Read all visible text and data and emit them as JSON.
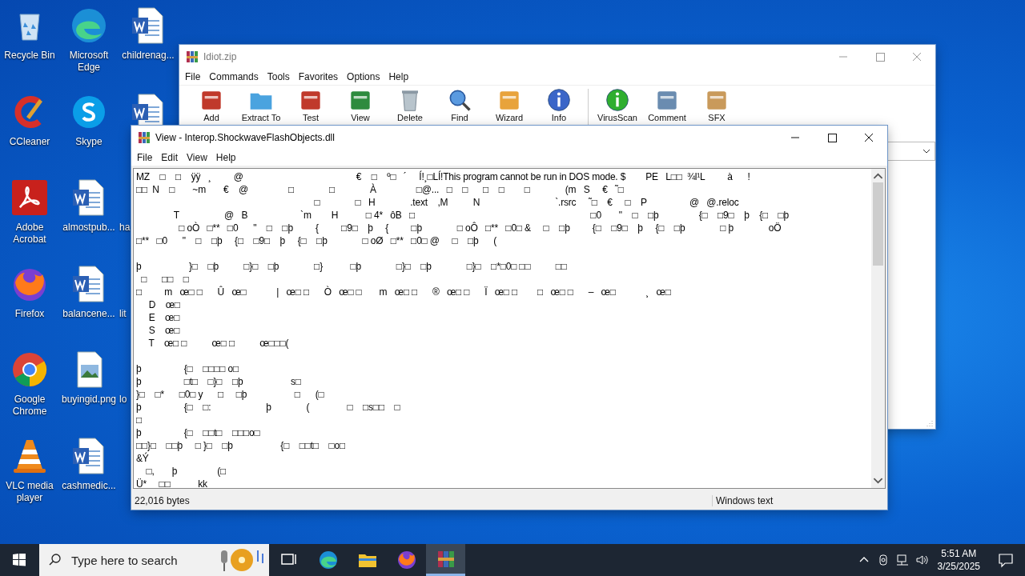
{
  "desktop": {
    "icons": [
      {
        "label": "Recycle Bin",
        "kind": "app"
      },
      {
        "label": "CCleaner",
        "kind": "app"
      },
      {
        "label": "Adobe Acrobat",
        "kind": "app"
      },
      {
        "label": "Firefox",
        "kind": "app"
      },
      {
        "label": "Google Chrome",
        "kind": "app"
      },
      {
        "label": "VLC media player",
        "kind": "app"
      },
      {
        "label": "Microsoft Edge",
        "kind": "app"
      },
      {
        "label": "Skype",
        "kind": "app"
      },
      {
        "label": "almostpub...",
        "kind": "document"
      },
      {
        "label": "balancene...",
        "kind": "document"
      },
      {
        "label": "buyingid.png",
        "kind": "image"
      },
      {
        "label": "cashmedic...",
        "kind": "document"
      },
      {
        "label": "childrenag...",
        "kind": "document"
      },
      {
        "kind": "document"
      },
      {
        "label": "ha",
        "kind": "covered"
      },
      {
        "label": "lit",
        "kind": "covered"
      },
      {
        "label": "lo",
        "kind": "covered"
      }
    ]
  },
  "archive_window": {
    "title": "Idiot.zip",
    "menu": [
      "File",
      "Commands",
      "Tools",
      "Favorites",
      "Options",
      "Help"
    ],
    "toolbar": [
      "Add",
      "Extract To",
      "Test",
      "View",
      "Delete",
      "Find",
      "Wizard",
      "Info",
      "VirusScan",
      "Comment",
      "SFX"
    ]
  },
  "viewer_window": {
    "title": "View - Interop.ShockwaveFlashObjects.dll",
    "menu": [
      "File",
      "Edit",
      "View",
      "Help"
    ],
    "lines": [
      {
        "text": "MZ    □    □    ÿÿ   ¸         @                                             €    □    º□   ´     Í!¸□LÍ!This program cannot be run in DOS mode. $        PE   L□□  ¾l¹L         à      !",
        "gap_before": false
      },
      {
        "text": "□□  N    □       ~m       €    @                □              □              À                □@...   □    □      □    □        □              (m   S     €   ˜□",
        "gap_before": false
      },
      {
        "text": "                                                                       □              □   H              .text    ,M          N                              `.rsrc     ˜□    €     □    P                 @   @.reloc",
        "gap_before": false
      },
      {
        "text": "               T                  @   B                     `m        H           □ 4*   ôB   □                                                                      □0       \"    □    □þ                {□    □9□    þ    {□    □þ",
        "gap_before": false
      },
      {
        "text": "                 □ oÒ   □**   □0      \"    □    □þ         {         □9□    þ     {         □þ              □ oÔ   □**   □0□ &     □    □þ         {□    □9□    þ     {□    □þ              □ þ              oÖ",
        "gap_before": false
      },
      {
        "text": "□**   □0      \"    □    □þ     {□    □9□    þ     {□    □þ              □ oØ   □**   □0□ @     □    □þ      (",
        "gap_before": false
      },
      {
        "text": "þ                   }□    □þ          □}□    □þ              □}           □þ              □}□    □þ              □}□    □*□0□ □□          □□",
        "gap_before": true
      },
      {
        "text": "  □      □□    □",
        "gap_before": false
      },
      {
        "text": "□         m   œ□ □      Û   œ□            |   œ□ □      Ò   œ□ □       m   œ□ □      ®   œ□ □      Ï   œ□ □        □   œ□ □      –   œ□            ¸   œ□",
        "gap_before": false
      },
      {
        "text": "     D    œ□",
        "gap_before": false
      },
      {
        "text": "     E    œ□",
        "gap_before": false
      },
      {
        "text": "     S    œ□",
        "gap_before": false
      },
      {
        "text": "     T    œ□ □          œ□ □          œ□□□(",
        "gap_before": false
      },
      {
        "text": "þ                 {□    □□□□ o□",
        "gap_before": true
      },
      {
        "text": "þ                 □t□    □}□    □þ                   s□",
        "gap_before": false
      },
      {
        "text": "}□    □*      □0□ y      □     □þ                   □      (□",
        "gap_before": false
      },
      {
        "text": "þ                 {□    □:                      þ              (               □    □s□□    □",
        "gap_before": false
      },
      {
        "text": "□",
        "gap_before": false
      },
      {
        "text": "þ                 {□    □□t□    □□□o□",
        "gap_before": false
      },
      {
        "text": "□□}□    □□þ     □ }□    □þ                   {□    □□t□    □o□",
        "gap_before": false
      },
      {
        "text": "&Ý",
        "gap_before": false
      },
      {
        "text": "    □,       þ                (□",
        "gap_before": false
      },
      {
        "text": "Ü*     □□           kk",
        "gap_before": false
      }
    ],
    "status": {
      "size": "22,016 bytes",
      "encoding": "Windows text"
    }
  },
  "taskbar": {
    "search_placeholder": "Type here to search",
    "apps": [
      {
        "selected": false
      },
      {
        "selected": false
      },
      {
        "selected": false
      },
      {
        "selected": false
      },
      {
        "selected": true
      }
    ],
    "time": "5:51 AM",
    "date": "3/25/2025"
  }
}
